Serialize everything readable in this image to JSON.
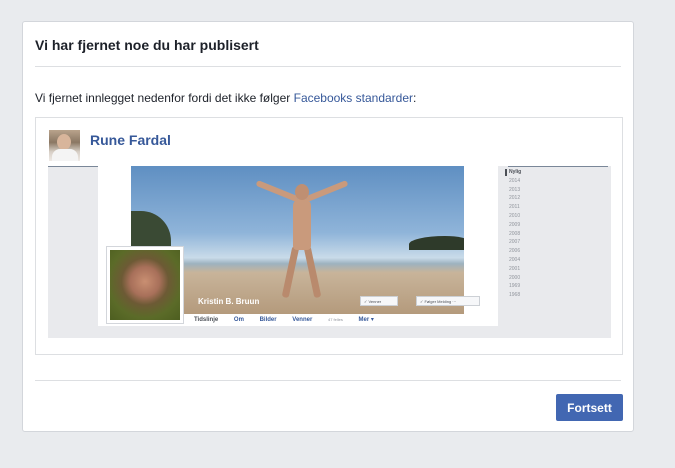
{
  "dialog": {
    "title": "Vi har fjernet noe du har publisert",
    "message_prefix": "Vi fjernet innlegget nedenfor fordi det ikke følger ",
    "message_link": "Facebooks standarder",
    "message_suffix": ":",
    "continue_label": "Fortsett",
    "accent_color": "#4267b2"
  },
  "post": {
    "author": "Rune Fardal",
    "screenshot": {
      "profile_name": "Kristin B. Bruun",
      "friends_button": "✓ Venner",
      "follow_button": "✓ Følger",
      "message_button": "Melding",
      "more_button": "···",
      "nav": {
        "timeline": "Tidslinje",
        "about": "Om",
        "photos": "Bilder",
        "friends": "Venner",
        "friends_count": "47 felles",
        "more": "Mer ▾"
      },
      "timeline_years": [
        "Nylig",
        "2014",
        "2013",
        "2012",
        "2011",
        "2010",
        "2009",
        "2008",
        "2007",
        "2006",
        "2004",
        "2001",
        "2000",
        "1969",
        "1968"
      ]
    }
  }
}
